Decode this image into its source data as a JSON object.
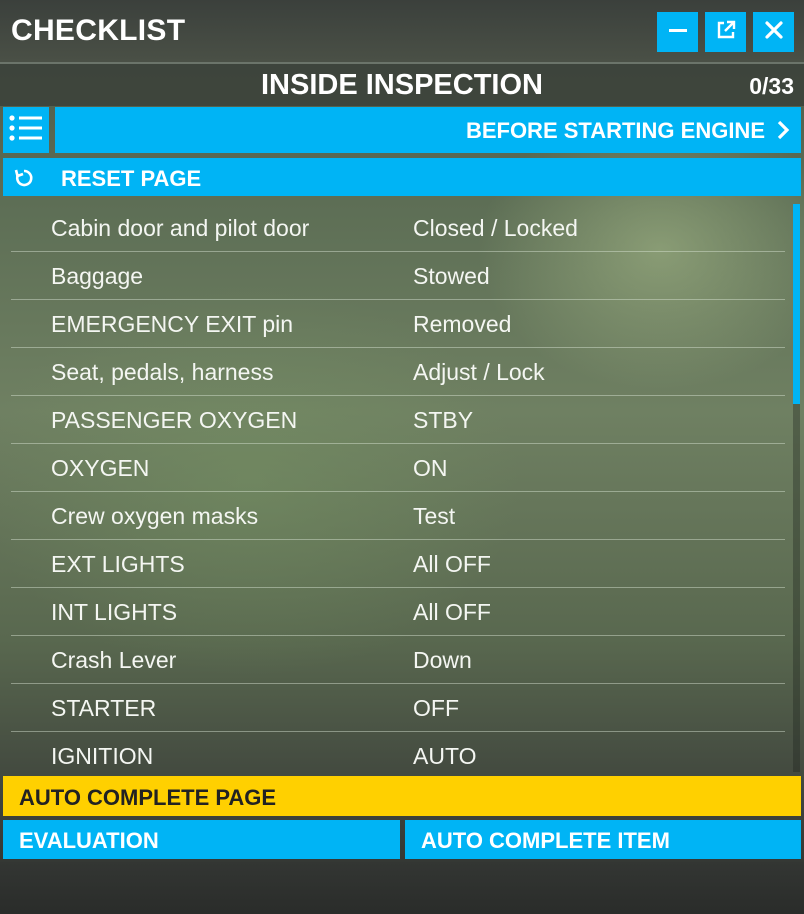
{
  "window": {
    "title": "CHECKLIST",
    "buttons": {
      "minimize_icon": "minimize-icon",
      "popout_icon": "popout-icon",
      "close_icon": "close-icon"
    }
  },
  "header": {
    "section_title": "INSIDE INSPECTION",
    "progress": "0/33"
  },
  "nav": {
    "list_icon": "list-icon",
    "next_label": "BEFORE STARTING ENGINE",
    "next_icon": "chevron-right-icon"
  },
  "reset": {
    "icon": "reset-icon",
    "label": "RESET PAGE"
  },
  "items": [
    {
      "label": "Cabin door and pilot door",
      "value": "Closed / Locked"
    },
    {
      "label": "Baggage",
      "value": "Stowed"
    },
    {
      "label": "EMERGENCY EXIT pin",
      "value": "Removed"
    },
    {
      "label": "Seat, pedals, harness",
      "value": "Adjust / Lock"
    },
    {
      "label": "PASSENGER OXYGEN",
      "value": "STBY"
    },
    {
      "label": "OXYGEN",
      "value": "ON"
    },
    {
      "label": "Crew oxygen masks",
      "value": "Test"
    },
    {
      "label": "EXT LIGHTS",
      "value": "All OFF"
    },
    {
      "label": "INT LIGHTS",
      "value": "All OFF"
    },
    {
      "label": "Crash Lever",
      "value": "Down"
    },
    {
      "label": "STARTER",
      "value": "OFF"
    },
    {
      "label": "IGNITION",
      "value": "AUTO"
    }
  ],
  "actions": {
    "auto_complete_page": "AUTO COMPLETE PAGE",
    "evaluation": "EVALUATION",
    "auto_complete_item": "AUTO COMPLETE ITEM"
  },
  "colors": {
    "accent": "#00b4f5",
    "highlight": "#ffd000"
  }
}
